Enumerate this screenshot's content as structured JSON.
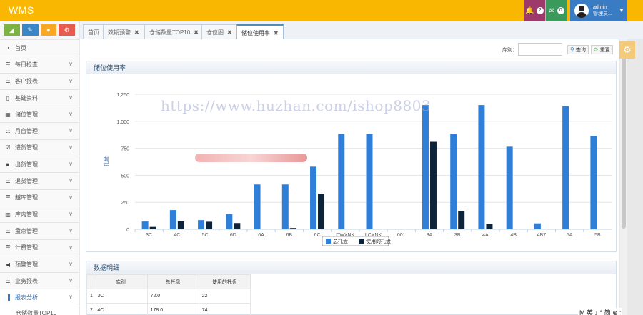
{
  "header": {
    "brand": "WMS",
    "notif1_count": "2",
    "notif2_count": "0",
    "user_name": "admin",
    "user_role": "管理员..."
  },
  "shortcuts": [
    "chart-icon",
    "pencil-icon",
    "users-icon",
    "cogs-icon"
  ],
  "sidebar": {
    "items": [
      {
        "label": "首页",
        "icon": "dashboard-icon"
      },
      {
        "label": "每日检查",
        "icon": "list-icon"
      },
      {
        "label": "客户报表",
        "icon": "list-icon"
      },
      {
        "label": "基础资料",
        "icon": "file-icon"
      },
      {
        "label": "储位管理",
        "icon": "building-icon"
      },
      {
        "label": "月台管理",
        "icon": "th-list-icon"
      },
      {
        "label": "进货管理",
        "icon": "check-icon"
      },
      {
        "label": "出货管理",
        "icon": "truck-icon"
      },
      {
        "label": "退货管理",
        "icon": "list-icon"
      },
      {
        "label": "越库管理",
        "icon": "list-icon"
      },
      {
        "label": "库内管理",
        "icon": "columns-icon"
      },
      {
        "label": "盘点管理",
        "icon": "list-icon"
      },
      {
        "label": "计费管理",
        "icon": "list-icon"
      },
      {
        "label": "预警管理",
        "icon": "volume-icon"
      },
      {
        "label": "业务报表",
        "icon": "list-icon"
      },
      {
        "label": "报表分析",
        "icon": "bar-chart-icon"
      }
    ],
    "sub_item": "仓储数量TOP10"
  },
  "tabs": [
    {
      "label": "首页",
      "closable": false
    },
    {
      "label": "效期预警",
      "closable": true
    },
    {
      "label": "仓储数量TOP10",
      "closable": true
    },
    {
      "label": "仓位图",
      "closable": true
    },
    {
      "label": "储位使用率",
      "closable": true,
      "active": true
    }
  ],
  "search": {
    "label": "库别：",
    "value": "",
    "query_label": "查询",
    "reset_label": "重置"
  },
  "chart_panel_title": "储位使用率",
  "chart_data": {
    "type": "bar",
    "title": "",
    "ylabel": "托盘",
    "ylim": [
      0,
      1250
    ],
    "yticks": [
      0,
      250,
      500,
      750,
      1000,
      1250
    ],
    "ytick_labels": [
      "0",
      "250",
      "500",
      "750",
      "1,000",
      "1,250"
    ],
    "categories": [
      "3C",
      "4C",
      "5C",
      "6D",
      "6A",
      "6B",
      "6C",
      "DWXNK",
      "LCXNK",
      "001",
      "3A",
      "3B",
      "4A",
      "4B",
      "4B7",
      "5A",
      "5B"
    ],
    "series": [
      {
        "name": "总托盘",
        "color": "#2f7ed8",
        "values": [
          72,
          178,
          85,
          140,
          415,
          415,
          580,
          885,
          885,
          0,
          1150,
          880,
          1150,
          765,
          55,
          1140,
          865
        ]
      },
      {
        "name": "使用的托盘",
        "color": "#0d233a",
        "values": [
          22,
          74,
          70,
          58,
          0,
          12,
          330,
          0,
          0,
          0,
          810,
          170,
          50,
          0,
          0,
          0,
          0
        ]
      }
    ],
    "grid": true,
    "legend": "bottom-center"
  },
  "table_panel_title": "数据明细",
  "table": {
    "headers": [
      "库别",
      "总托盘",
      "使用的托盘"
    ],
    "rows": [
      [
        "1",
        "3C",
        "72.0",
        "22"
      ],
      [
        "2",
        "4C",
        "178.0",
        "74"
      ]
    ]
  },
  "watermark": "https://www.huzhan.com/ishop8803",
  "ime": "M 英 ♪ ° 简 ⊕ ∶"
}
